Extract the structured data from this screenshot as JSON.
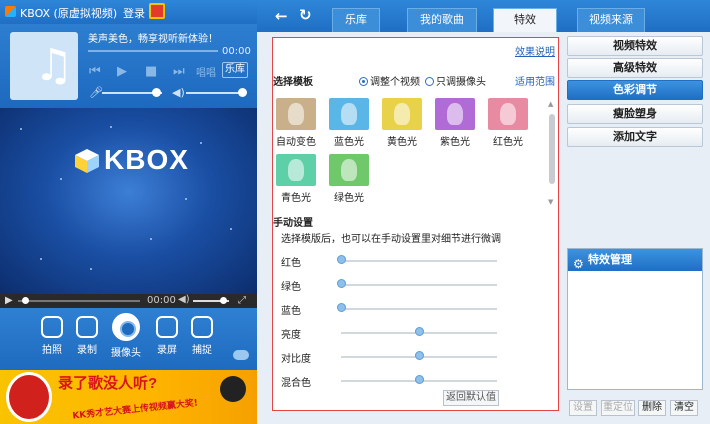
{
  "app": {
    "title": "KBOX (原虚拟视频)",
    "login": "登录",
    "song_title": "美声美色，畅享视听新体验！",
    "time": "00:00",
    "sing_label": "唱唱",
    "library_label": "乐库",
    "video_brand": "KBOX",
    "bar_time": "00:00"
  },
  "tools": [
    {
      "label": "拍照",
      "icon": "camera-icon"
    },
    {
      "label": "录制",
      "icon": "record-icon"
    },
    {
      "label": "摄像头",
      "icon": "webcam-icon"
    },
    {
      "label": "录屏",
      "icon": "screen-record-icon"
    },
    {
      "label": "捕捉",
      "icon": "capture-icon"
    }
  ],
  "banner": {
    "title": "录了歌没人听?",
    "subtitle": "KK秀才艺大赛上传视频赢大奖!"
  },
  "nav": {
    "tabs": [
      {
        "label": "乐库",
        "active": false
      },
      {
        "label": "我的歌曲",
        "active": false
      },
      {
        "label": "特效",
        "active": true
      },
      {
        "label": "视频来源",
        "active": false
      }
    ]
  },
  "effects": {
    "instructions_link": "效果说明",
    "template_heading": "选择模板",
    "radio_whole": "调整个视频",
    "radio_camera": "只调摄像头",
    "scope_link": "适用范围",
    "templates": [
      {
        "label": "自动变色",
        "color": "#c9b08a"
      },
      {
        "label": "蓝色光",
        "color": "#5bb6e8"
      },
      {
        "label": "黄色光",
        "color": "#e7d24a"
      },
      {
        "label": "紫色光",
        "color": "#b16bd6"
      },
      {
        "label": "红色光",
        "color": "#e88aa2"
      },
      {
        "label": "青色光",
        "color": "#5fcfa8"
      },
      {
        "label": "绿色光",
        "color": "#6fc86a"
      }
    ],
    "manual_heading": "手动设置",
    "manual_tip": "选择模版后，也可以在手动设置里对细节进行微调",
    "sliders": [
      {
        "label": "红色",
        "value": 0
      },
      {
        "label": "绿色",
        "value": 0
      },
      {
        "label": "蓝色",
        "value": 0
      },
      {
        "label": "亮度",
        "value": 50
      },
      {
        "label": "对比度",
        "value": 50
      },
      {
        "label": "混合色",
        "value": 50
      }
    ],
    "reset_label": "返回默认值"
  },
  "side_menu": [
    {
      "label": "视频特效",
      "active": false
    },
    {
      "label": "高级特效",
      "active": false
    },
    {
      "label": "色彩调节",
      "active": true
    },
    {
      "label": "瘦脸塑身",
      "active": false
    },
    {
      "label": "添加文字",
      "active": false
    }
  ],
  "manager": {
    "title": "特效管理",
    "buttons": [
      {
        "label": "设置",
        "enabled": false
      },
      {
        "label": "重定位",
        "enabled": false
      },
      {
        "label": "删除",
        "enabled": true
      },
      {
        "label": "清空",
        "enabled": true
      }
    ]
  }
}
